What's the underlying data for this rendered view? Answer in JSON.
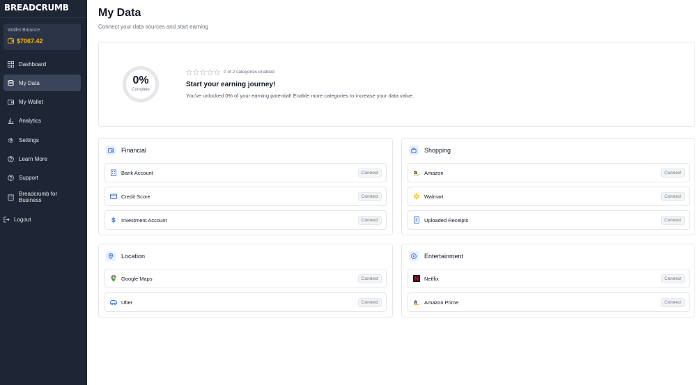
{
  "brand": {
    "name": "BREADCRUMB"
  },
  "wallet": {
    "label": "Wallet Balance",
    "amount": "$7067.42",
    "icon": "wallet-icon",
    "accent": "#f5b400"
  },
  "nav": {
    "items": [
      {
        "label": "Dashboard",
        "icon": "dashboard-icon",
        "active": false
      },
      {
        "label": "My Data",
        "icon": "database-icon",
        "active": true
      },
      {
        "label": "My Wallet",
        "icon": "wallet-icon",
        "active": false
      },
      {
        "label": "Analytics",
        "icon": "bar-chart-icon",
        "active": false
      },
      {
        "label": "Settings",
        "icon": "gear-icon",
        "active": false
      },
      {
        "label": "Learn More",
        "icon": "help-icon",
        "active": false
      },
      {
        "label": "Support",
        "icon": "support-icon",
        "active": false
      },
      {
        "label": "Breadcrumb for Business",
        "icon": "building-icon",
        "active": false
      }
    ],
    "logout": "Logout"
  },
  "page": {
    "title": "My Data",
    "subtitle": "Connect your data sources and start earning"
  },
  "progress": {
    "value": "0%",
    "label": "Complete",
    "stars_filled": 0,
    "stars_total": 5,
    "categories_text": "0 of 2 categories enabled",
    "title": "Start your earning journey!",
    "description": "You've unlocked 0% of your earning potential! Enable more categories to increase your data value."
  },
  "categories": [
    {
      "name": "Financial",
      "icon": "wallet-icon",
      "items": [
        {
          "label": "Bank Account",
          "icon": "bank-icon",
          "action": "Connect"
        },
        {
          "label": "Credit Score",
          "icon": "credit-card-icon",
          "action": "Connect"
        },
        {
          "label": "Investment Account",
          "icon": "dollar-icon",
          "action": "Connect"
        }
      ]
    },
    {
      "name": "Shopping",
      "icon": "shopping-bag-icon",
      "items": [
        {
          "label": "Amazon",
          "icon": "amazon-logo-icon",
          "action": "Connect"
        },
        {
          "label": "Walmart",
          "icon": "walmart-logo-icon",
          "action": "Connect"
        },
        {
          "label": "Uploaded Receipts",
          "icon": "receipt-icon",
          "action": "Connect"
        }
      ]
    },
    {
      "name": "Location",
      "icon": "map-pin-icon",
      "items": [
        {
          "label": "Google Maps",
          "icon": "google-maps-logo-icon",
          "action": "Connect"
        },
        {
          "label": "Uber",
          "icon": "car-icon",
          "action": "Connect"
        }
      ]
    },
    {
      "name": "Entertainment",
      "icon": "play-icon",
      "items": [
        {
          "label": "Netflix",
          "icon": "netflix-logo-icon",
          "action": "Connect"
        },
        {
          "label": "Amazon Prime",
          "icon": "amazon-logo-icon",
          "action": "Connect"
        }
      ]
    }
  ],
  "colors": {
    "sidebar": "#1e2535",
    "accent_blue": "#3b6fd8",
    "wallet_gold": "#f5b400"
  }
}
